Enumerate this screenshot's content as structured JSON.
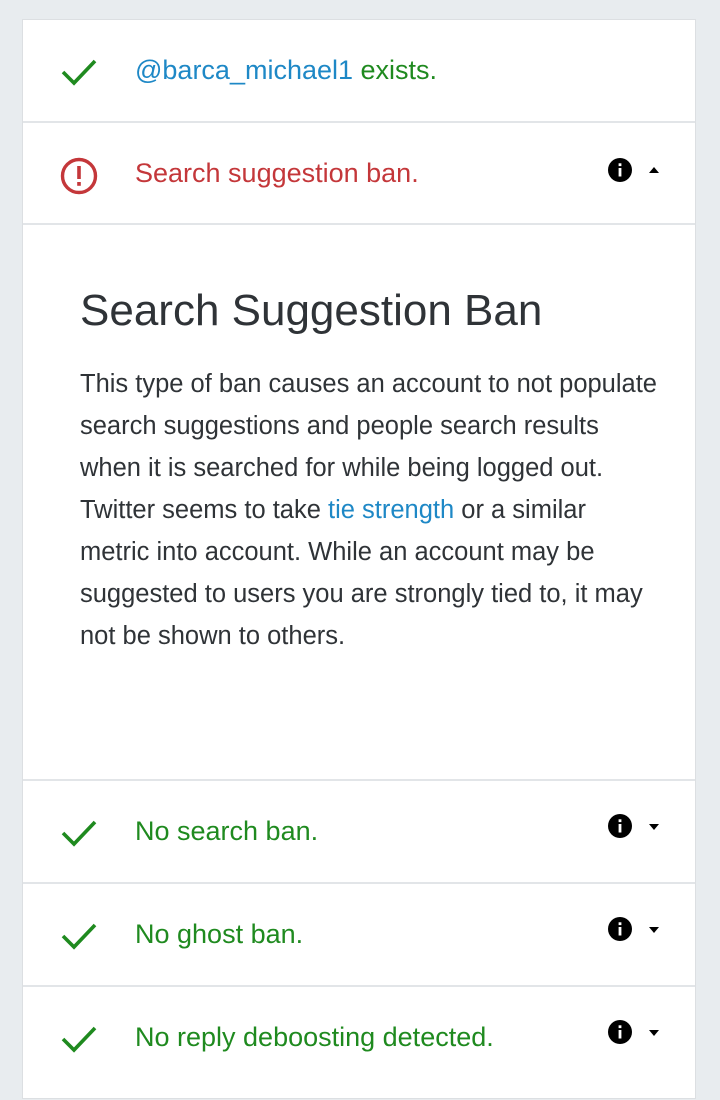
{
  "results": [
    {
      "status": "ok",
      "icon": "checkmark-icon",
      "handle": "@barca_michael1",
      "text": " exists.",
      "expandable": false
    },
    {
      "status": "warning",
      "icon": "exclamation-circle-icon",
      "text": "Search suggestion ban.",
      "expandable": true,
      "expanded": true,
      "detail": {
        "title": "Search Suggestion Ban",
        "body_part1": "This type of ban causes an account to not populate search suggestions and people search results when it is searched for while being logged out. Twitter seems to take ",
        "link_text": "tie strength",
        "body_part2": " or a similar metric into account. While an account may be suggested to users you are strongly tied to, it may not be shown to others."
      }
    },
    {
      "status": "ok",
      "icon": "checkmark-icon",
      "text": "No search ban.",
      "expandable": true,
      "expanded": false
    },
    {
      "status": "ok",
      "icon": "checkmark-icon",
      "text": "No ghost ban.",
      "expandable": true,
      "expanded": false
    },
    {
      "status": "ok",
      "icon": "checkmark-icon",
      "text": "No reply deboosting detected.",
      "expandable": true,
      "expanded": false
    }
  ],
  "colors": {
    "ok": "#1f8a1f",
    "warning": "#c4373a",
    "link": "#1e88c6",
    "text": "#2f3337",
    "background": "#e8ecef",
    "divider": "#e2e5e8"
  }
}
